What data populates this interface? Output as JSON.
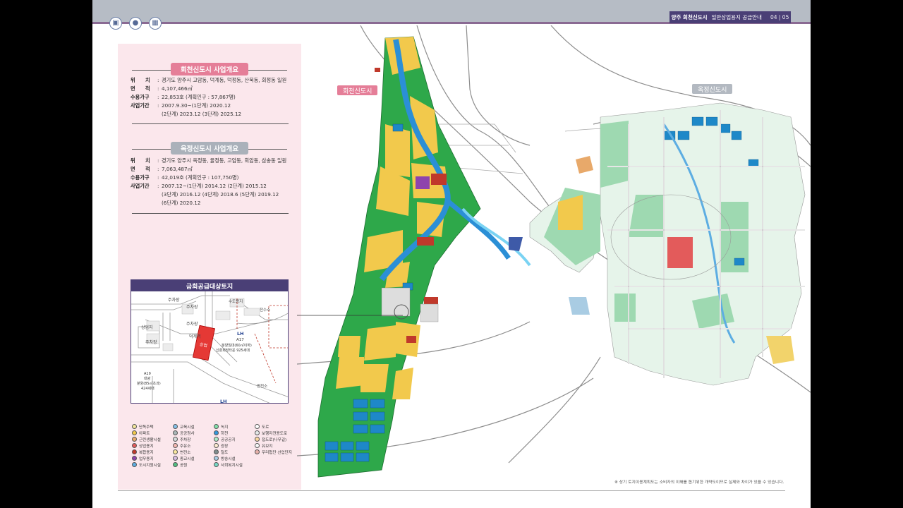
{
  "header": {
    "title_bold": "양주 회천신도시",
    "title_rest": "일반상업용지 공급안내",
    "page": "04 | 05"
  },
  "nav_icons": [
    "car-icon",
    "location-pin-icon",
    "building-icon"
  ],
  "hoecheon": {
    "title": "회천신도시 사업개요",
    "rows": [
      {
        "k": "위　　치",
        "v": "경기도 양주시 고암동, 덕계동, 덕정동, 산북동, 회정동 일원"
      },
      {
        "k": "면　　적",
        "v": "4,107,466㎡"
      },
      {
        "k": "수용가구",
        "v": "22,853호 (계획인구 : 57,867명)"
      },
      {
        "k": "사업기간",
        "v": "2007.9.30~(1단계) 2020.12"
      },
      {
        "k": "",
        "v": "(2단계) 2023.12 (3단계) 2025.12"
      }
    ]
  },
  "okjeong": {
    "title": "옥정신도시 사업개요",
    "rows": [
      {
        "k": "위　　치",
        "v": "경기도 양주시 옥정동, 율정동, 고암동, 회암동, 삼송동 일원"
      },
      {
        "k": "면　　적",
        "v": "7,063,487㎡"
      },
      {
        "k": "수용가구",
        "v": "42,019호 (계획인구 : 107,750명)"
      },
      {
        "k": "사업기간",
        "v": "2007.12~(1단계) 2014.12 (2단계) 2015.12"
      },
      {
        "k": "",
        "v": "(3단계) 2016.12 (4단계) 2018.6 (5단계) 2019.12"
      },
      {
        "k": "",
        "v": "(6단계) 2020.12"
      }
    ]
  },
  "inset": {
    "title": "금회공급대상토지",
    "labels": {
      "jucha1": "주차장",
      "jucha2": "주차장",
      "jucha3": "주차장",
      "jucha4": "주차장",
      "sangeop": "상업지",
      "deokgye": "덕계역",
      "jeonsuso": "전수소",
      "sudo": "수도용지",
      "jeonsu_bot": "변전소",
      "lh": "LH",
      "a17": "A17",
      "a17_desc1": "분양임대(60㎡이하)",
      "a17_desc2": "신혼희망타운 925세대",
      "a19": "A19",
      "a19_desc1": "대광",
      "a19_desc2": "분양(85㎡초과)",
      "a19_desc3": "424세대",
      "lh_bot": "LH",
      "target": "상업"
    }
  },
  "legend": [
    [
      {
        "label": "단독주택",
        "color": "#f3e79b"
      },
      {
        "label": "아파트",
        "color": "#f2c94c"
      },
      {
        "label": "근린생활시설",
        "color": "#e8a96a"
      },
      {
        "label": "상업용지",
        "color": "#e35b5b"
      },
      {
        "label": "복합용지",
        "color": "#c0392b"
      },
      {
        "label": "업무용지",
        "color": "#8e44ad"
      },
      {
        "label": "도시지원시설",
        "color": "#5dade2"
      }
    ],
    [
      {
        "label": "교육시설",
        "color": "#85c1e9"
      },
      {
        "label": "공공청사",
        "color": "#aab7b8"
      },
      {
        "label": "주차장",
        "color": "#d5dbdb"
      },
      {
        "label": "주유소",
        "color": "#f5b7b1"
      },
      {
        "label": "변전소",
        "color": "#f9e79f"
      },
      {
        "label": "종교시설",
        "color": "#d7bde2"
      },
      {
        "label": "공원",
        "color": "#52be80"
      }
    ],
    [
      {
        "label": "녹지",
        "color": "#82e0aa"
      },
      {
        "label": "하천",
        "color": "#3498db"
      },
      {
        "label": "공공공지",
        "color": "#abebc6"
      },
      {
        "label": "광장",
        "color": "#fdebd0"
      },
      {
        "label": "철도",
        "color": "#7f8c8d"
      },
      {
        "label": "방송시설",
        "color": "#a9cce3"
      },
      {
        "label": "사회복지시설",
        "color": "#76d7c4"
      }
    ],
    [
      {
        "label": "도로",
        "color": "#ffffff"
      },
      {
        "label": "보행자전용도로",
        "color": "#e5e8e8"
      },
      {
        "label": "접도로(나무길)",
        "color": "#fad7a0"
      },
      {
        "label": "유보지",
        "color": "#f8f9f9"
      },
      {
        "label": "우리협단 선업단지",
        "color": "#e6b0aa"
      }
    ]
  ],
  "map": {
    "tag_hoecheon": "회천신도시",
    "tag_okjeong": "옥정신도시",
    "color_hoecheon_tag": "#e57e98",
    "color_okjeong_tag": "#b3b9c1"
  },
  "footnote": "※ 상기 토지이용계획도는 소비자의 이해를 돕기위한 개략도이므로 실제와 차이가 있을 수 있습니다."
}
